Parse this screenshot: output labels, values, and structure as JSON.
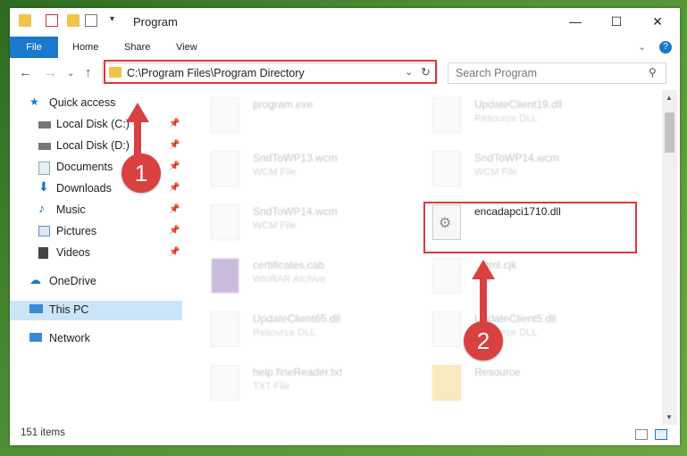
{
  "window": {
    "title": "Program",
    "minimize": "—",
    "maximize": "☐",
    "close": "✕"
  },
  "ribbon": {
    "file": "File",
    "tabs": [
      "Home",
      "Share",
      "View"
    ],
    "help": "?"
  },
  "nav": {
    "back": "←",
    "forward": "→",
    "up": "↑",
    "address": "C:\\Program Files\\Program Directory",
    "search_placeholder": "Search Program"
  },
  "sidebar": {
    "items": [
      {
        "label": "Quick access",
        "icon": "star-icon",
        "pinned": false
      },
      {
        "label": "Local Disk (C:)",
        "icon": "drive-icon",
        "pinned": true
      },
      {
        "label": "Local Disk (D:)",
        "icon": "drive-icon",
        "pinned": true
      },
      {
        "label": "Documents",
        "icon": "documents-icon",
        "pinned": true
      },
      {
        "label": "Downloads",
        "icon": "download-icon",
        "pinned": true
      },
      {
        "label": "Music",
        "icon": "music-icon",
        "pinned": true
      },
      {
        "label": "Pictures",
        "icon": "pictures-icon",
        "pinned": true
      },
      {
        "label": "Videos",
        "icon": "videos-icon",
        "pinned": true
      },
      {
        "label": "OneDrive",
        "icon": "cloud-icon",
        "pinned": false
      },
      {
        "label": "This PC",
        "icon": "computer-icon",
        "pinned": false
      },
      {
        "label": "Network",
        "icon": "network-icon",
        "pinned": false
      }
    ]
  },
  "files": [
    {
      "name": "program.exe",
      "type": ""
    },
    {
      "name": "UpdateClient19.dll",
      "type": "Resource DLL"
    },
    {
      "name": "SndToWP13.wcm",
      "type": "WCM File"
    },
    {
      "name": "SndToWP14.wcm",
      "type": "WCM File"
    },
    {
      "name": "SndToWP14.wcm",
      "type": "WCM File"
    },
    {
      "name": "encadapci1710.dll",
      "type": ""
    },
    {
      "name": "certificates.cab",
      "type": "WinRAR Archive"
    },
    {
      "name": "...ftml.cjk",
      "type": "File"
    },
    {
      "name": "UpdateClient65.dll",
      "type": "Resource DLL"
    },
    {
      "name": "UpdateClient5.dll",
      "type": "Resource DLL"
    },
    {
      "name": "help.fineReader.txt",
      "type": "TXT File"
    },
    {
      "name": "Resource",
      "type": ""
    }
  ],
  "status": {
    "count": "151 items"
  },
  "annotations": {
    "step1": "1",
    "step2": "2"
  },
  "colors": {
    "accent": "#1979ca",
    "highlight": "#d93a3a",
    "selected": "#cce4f7"
  }
}
